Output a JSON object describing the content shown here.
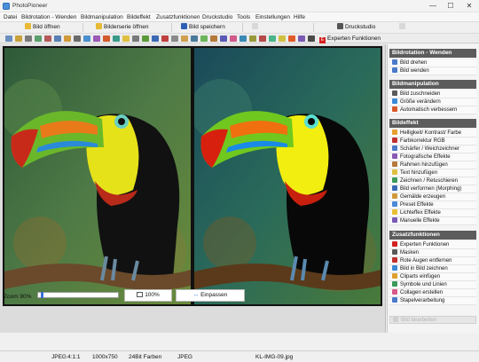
{
  "window": {
    "title": "PhotoPioneer",
    "minimize": "—",
    "maximize": "☐",
    "close": "✕"
  },
  "menu": [
    "Datei",
    "Bildrotation - Wenden",
    "Bildmanipulation",
    "Bildeffekt",
    "Zusatzfunktionen",
    "Druckstudio",
    "Tools",
    "Einstellungen",
    "Hilfe"
  ],
  "toolbar": {
    "open": "Bild öffnen",
    "series": "Bilderserie öffnen",
    "save": "Bild speichern",
    "print": "Druckstudio",
    "expert": "Experten Funktionen"
  },
  "sidebar": {
    "sections": [
      {
        "title": "Bildrotation - Wenden",
        "items": [
          "Bild drehen",
          "Bild wenden"
        ]
      },
      {
        "title": "Bildmanipulation",
        "items": [
          "Bild zuschneiden",
          "Größe verändern",
          "Automatisch verbessern"
        ]
      },
      {
        "title": "Bildeffekt",
        "items": [
          "Helligkeit/ Kontrast/ Farbe",
          "Farbkorrektur RGB",
          "Schärfer / Weichzeichner",
          "Fotografische Effekte",
          "Rahmen hinzufügen",
          "Text hinzufügen",
          "Zeichnen / Retuschieren",
          "Bild verformen (Morphing)",
          "Gemälde erzeugen",
          "Preset Effekte",
          "Lichteffex Effekte",
          "Manuelle Effekte"
        ]
      },
      {
        "title": "Zusatzfunktionen",
        "items": [
          "Experten Funktionen",
          "Masken",
          "Rote Augen entfernen",
          "Bild in Bild zeichnen",
          "Cliparts einfügen",
          "Symbole und Linien",
          "Collagen erstellen",
          "Stapelverarbeitung"
        ]
      }
    ],
    "footer": "Bild bearbeiten"
  },
  "zoom": {
    "label": "Zoom 90%",
    "level": 0.04,
    "btn100": "100%",
    "fit": "Einpassen"
  },
  "status": {
    "format": "JPEG",
    "ratio": "4:1:1",
    "size": "1000x750",
    "colors": "24Bit Farben",
    "type": "JPEG",
    "file": "KL-IMG-09.jpg"
  }
}
